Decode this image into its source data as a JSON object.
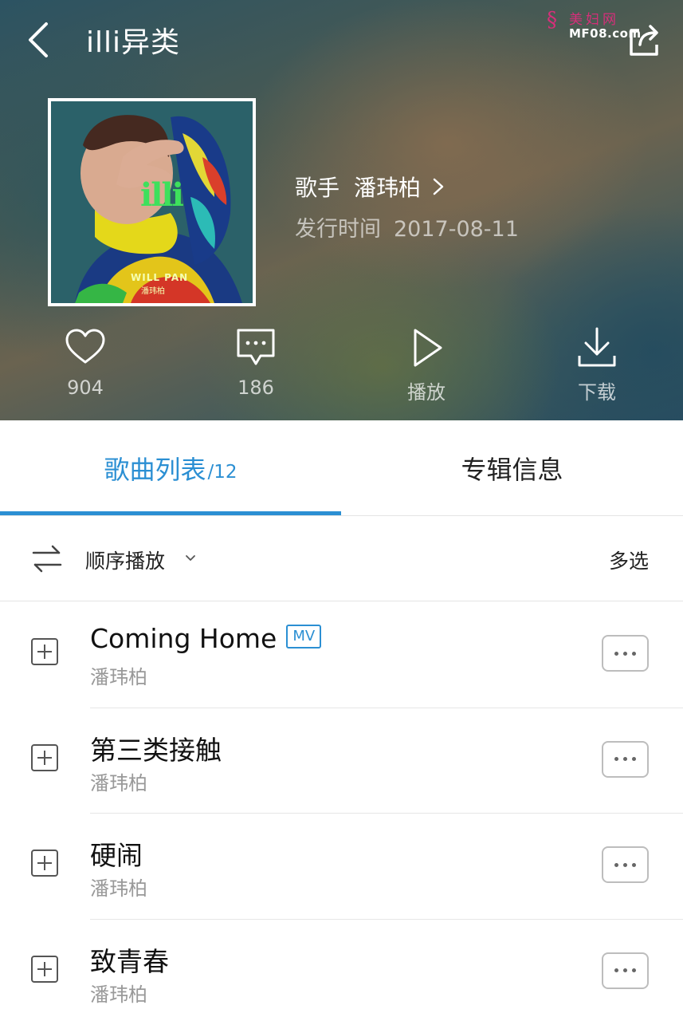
{
  "header": {
    "title": "illi异类",
    "back_icon": "chevron-left-icon",
    "share_icon": "share-icon",
    "watermark": {
      "cn": "美妇网",
      "en": "MF08.com"
    }
  },
  "album": {
    "cover_text": {
      "logo": "illi",
      "artist_en": "WILL PAN",
      "artist_cn": "潘玮柏"
    },
    "artist_label": "歌手",
    "artist_name": "潘玮柏",
    "release_label": "发行时间",
    "release_date": "2017-08-11"
  },
  "actions": {
    "like": {
      "icon": "heart-icon",
      "label": "904"
    },
    "comment": {
      "icon": "comment-icon",
      "label": "186"
    },
    "play": {
      "icon": "play-icon",
      "label": "播放"
    },
    "download": {
      "icon": "download-icon",
      "label": "下载"
    }
  },
  "tabs": {
    "songs": {
      "label": "歌曲列表",
      "count": "/12",
      "active": true
    },
    "info": {
      "label": "专辑信息",
      "active": false
    }
  },
  "playbar": {
    "mode_label": "顺序播放",
    "multi_select": "多选"
  },
  "songs": [
    {
      "title": "Coming Home",
      "badge": "MV",
      "artist": "潘玮柏"
    },
    {
      "title": "第三类接触",
      "badge": "",
      "artist": "潘玮柏"
    },
    {
      "title": "硬闹",
      "badge": "",
      "artist": "潘玮柏"
    },
    {
      "title": "致青春",
      "badge": "",
      "artist": "潘玮柏"
    }
  ],
  "colors": {
    "accent": "#2b8fd3",
    "watermark": "#d62f7a"
  }
}
